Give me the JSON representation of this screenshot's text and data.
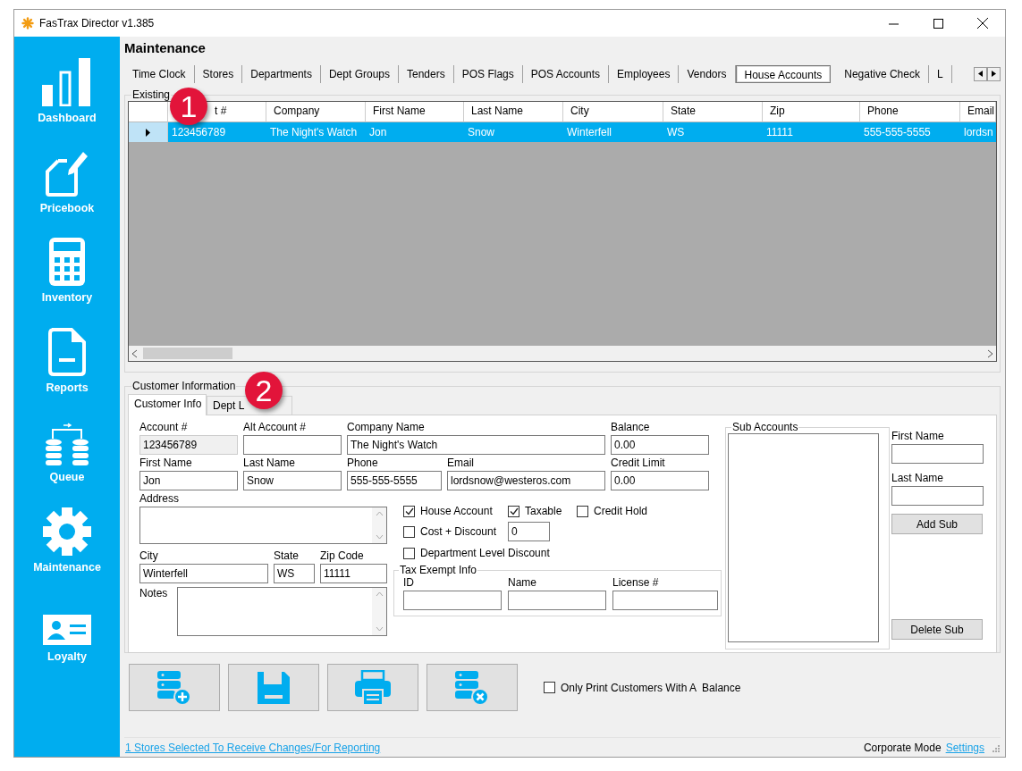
{
  "window": {
    "title": "FasTrax Director v1.385"
  },
  "sidebar": {
    "items": [
      {
        "label": "Dashboard",
        "kind": "chart"
      },
      {
        "label": "Pricebook",
        "kind": "pricebook"
      },
      {
        "label": "Inventory",
        "kind": "calculator"
      },
      {
        "label": "Reports",
        "kind": "report"
      },
      {
        "label": "Queue",
        "kind": "queue"
      },
      {
        "label": "Maintenance",
        "kind": "gear"
      },
      {
        "label": "Loyalty",
        "kind": "card"
      }
    ]
  },
  "page_title": "Maintenance",
  "tabs": [
    {
      "label": "Time Clock",
      "selected": false
    },
    {
      "label": "Stores",
      "selected": false
    },
    {
      "label": "Departments",
      "selected": false
    },
    {
      "label": "Dept Groups",
      "selected": false
    },
    {
      "label": "Tenders",
      "selected": false
    },
    {
      "label": "POS Flags",
      "selected": false
    },
    {
      "label": "POS Accounts",
      "selected": false
    },
    {
      "label": "Employees",
      "selected": false
    },
    {
      "label": "Vendors",
      "selected": false
    },
    {
      "label": "House Accounts",
      "selected": true
    },
    {
      "label": "Negative Check",
      "selected": false
    },
    {
      "label": "L",
      "selected": false
    }
  ],
  "existing": {
    "title": "Existing",
    "callout": "1",
    "columns": [
      "t #",
      "Company",
      "First Name",
      "Last Name",
      "City",
      "State",
      "Zip",
      "Phone",
      "Email"
    ],
    "rows": [
      {
        "selected": true,
        "cells": [
          "123456789",
          "The Night's Watch",
          "Jon",
          "Snow",
          "Winterfell",
          "WS",
          "11111",
          "555-555-5555",
          "lordsn"
        ]
      }
    ]
  },
  "customer_info": {
    "title": "Customer Information",
    "callout": "2",
    "tabs": [
      {
        "label": "Customer Info",
        "selected": true
      },
      {
        "label": "Dept L",
        "selected": false
      }
    ],
    "form": {
      "fields": [
        {
          "label": "Account #",
          "value": "123456789",
          "disabled": true
        },
        {
          "label": "Alt Account #",
          "disabled": false
        },
        {
          "label": "Company Name",
          "value": "The Night's Watch",
          "disabled": false
        },
        {
          "label": "Balance",
          "value": "0.00",
          "disabled": false
        },
        {
          "label": "First Name",
          "value": "Jon",
          "disabled": false
        },
        {
          "label": "Last Name",
          "value": "Snow",
          "disabled": false
        },
        {
          "label": "Phone",
          "value": "555-555-5555",
          "disabled": false
        },
        {
          "label": "Email",
          "value": "lordsnow@westeros.com",
          "disabled": false
        },
        {
          "label": "Credit Limit",
          "value": "0.00",
          "disabled": false
        }
      ],
      "address": {
        "label": "Address"
      },
      "location": [
        {
          "label": "City",
          "value": "Winterfell"
        },
        {
          "label": "State",
          "value": "WS"
        },
        {
          "label": "Zip Code",
          "value": "11111"
        }
      ],
      "notes": {
        "label": "Notes"
      },
      "options": [
        {
          "label": "House Account",
          "checked": true
        },
        {
          "label": "Taxable",
          "checked": true
        },
        {
          "label": "Credit Hold",
          "checked": false
        },
        {
          "label": "Cost + Discount",
          "checked": false,
          "value": "0"
        },
        {
          "label": "Department Level Discount",
          "checked": false
        }
      ],
      "tax_exempt": {
        "title": "Tax Exempt Info",
        "fields": [
          {
            "label": "ID"
          },
          {
            "label": "Name"
          },
          {
            "label": "License #"
          }
        ]
      }
    },
    "sub_accounts": {
      "title": "Sub Accounts",
      "fields": [
        {
          "label": "First Name"
        },
        {
          "label": "Last Name"
        }
      ],
      "buttons": [
        "Add Sub",
        "Delete Sub"
      ]
    }
  },
  "toolbar": {
    "buttons": [
      {
        "kind": "add"
      },
      {
        "kind": "save"
      },
      {
        "kind": "print"
      },
      {
        "kind": "delete"
      }
    ],
    "option": {
      "label": "Only Print Customers With A  Balance",
      "checked": false
    }
  },
  "status_bar": {
    "link": "1 Stores Selected To Receive Changes/For Reporting",
    "mode": "Corporate Mode",
    "settings": "Settings"
  }
}
